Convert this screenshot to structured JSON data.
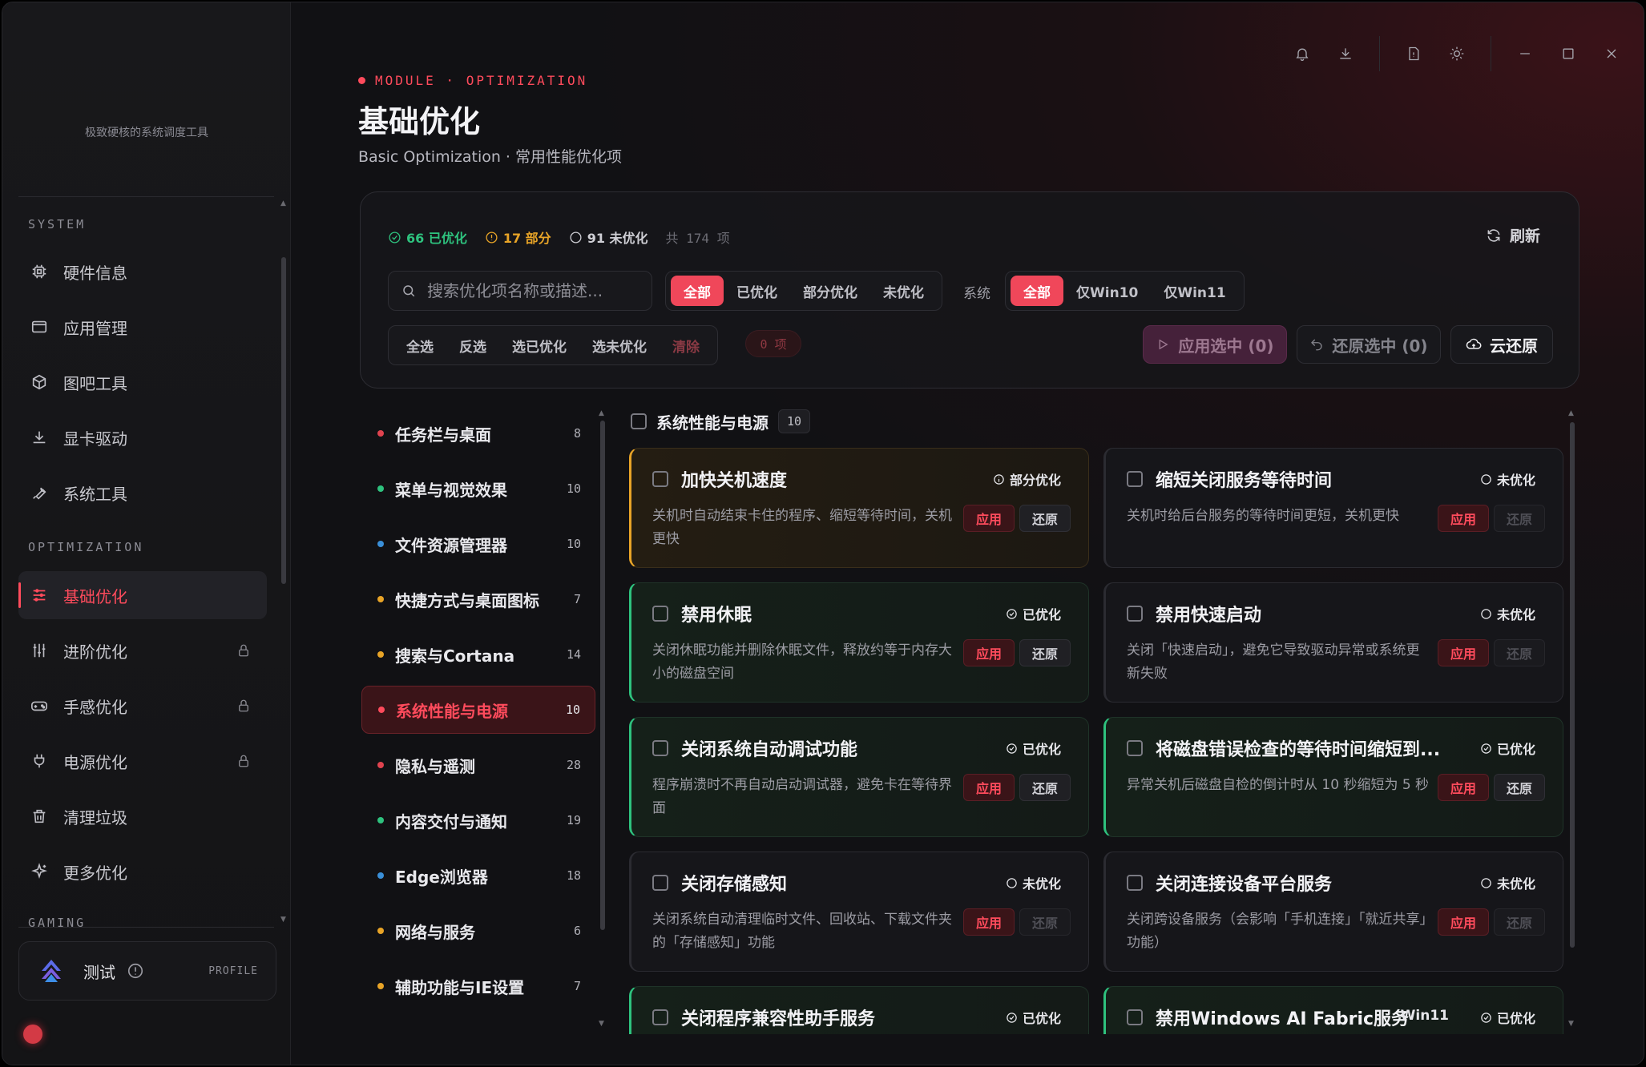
{
  "brand": {
    "tagline": "极致硬核的系统调度工具"
  },
  "sidebar": {
    "sections": [
      {
        "label": "SYSTEM"
      },
      {
        "label": "OPTIMIZATION"
      },
      {
        "label": "GAMING"
      }
    ],
    "items": [
      {
        "label": "硬件信息",
        "icon": "chip-icon",
        "locked": false,
        "active": false
      },
      {
        "label": "应用管理",
        "icon": "window-icon",
        "locked": false,
        "active": false
      },
      {
        "label": "图吧工具",
        "icon": "box-icon",
        "locked": false,
        "active": false
      },
      {
        "label": "显卡驱动",
        "icon": "download-icon",
        "locked": false,
        "active": false
      },
      {
        "label": "系统工具",
        "icon": "wrench-icon",
        "locked": false,
        "active": false
      },
      {
        "label": "基础优化",
        "icon": "sliders-icon",
        "locked": false,
        "active": true
      },
      {
        "label": "进阶优化",
        "icon": "tuning-icon",
        "locked": true,
        "active": false
      },
      {
        "label": "手感优化",
        "icon": "gamepad-icon",
        "locked": true,
        "active": false
      },
      {
        "label": "电源优化",
        "icon": "plug-icon",
        "locked": true,
        "active": false
      },
      {
        "label": "清理垃圾",
        "icon": "trash-icon",
        "locked": false,
        "active": false
      },
      {
        "label": "更多优化",
        "icon": "sparkle-icon",
        "locked": false,
        "active": false
      }
    ],
    "profile": {
      "name": "测试",
      "label": "PROFILE"
    }
  },
  "header": {
    "module_tag": "MODULE · OPTIMIZATION",
    "title": "基础优化",
    "subtitle": "Basic Optimization · 常用性能优化项"
  },
  "stats": {
    "optimized": "66 已优化",
    "partial": "17 部分",
    "unoptimized": "91 未优化",
    "total": "共 174 项",
    "refresh_label": "刷新"
  },
  "search": {
    "placeholder": "搜索优化项名称或描述..."
  },
  "filters": {
    "status": [
      "全部",
      "已优化",
      "部分优化",
      "未优化"
    ],
    "status_selected": "全部",
    "system_label": "系统",
    "system": [
      "全部",
      "仅Win10",
      "仅Win11"
    ],
    "system_selected": "全部"
  },
  "selection": {
    "actions": [
      "全选",
      "反选",
      "选已优化",
      "选未优化",
      "清除"
    ],
    "count": "0 项",
    "apply_selected": "应用选中 (0)",
    "restore_selected": "还原选中 (0)",
    "cloud_restore": "云还原"
  },
  "categories": [
    {
      "name": "任务栏与桌面",
      "count": "8",
      "dot": "#e0434f",
      "active": false
    },
    {
      "name": "菜单与视觉效果",
      "count": "10",
      "dot": "#2ec27e",
      "active": false
    },
    {
      "name": "文件资源管理器",
      "count": "10",
      "dot": "#3a8fd8",
      "active": false
    },
    {
      "name": "快捷方式与桌面图标",
      "count": "7",
      "dot": "#e8a427",
      "active": false
    },
    {
      "name": "搜索与Cortana",
      "count": "14",
      "dot": "#e8a427",
      "active": false
    },
    {
      "name": "系统性能与电源",
      "count": "10",
      "dot": "#ff4b5c",
      "active": true
    },
    {
      "name": "隐私与遥测",
      "count": "28",
      "dot": "#e0434f",
      "active": false
    },
    {
      "name": "内容交付与通知",
      "count": "19",
      "dot": "#2ec27e",
      "active": false
    },
    {
      "name": "Edge浏览器",
      "count": "18",
      "dot": "#3a8fd8",
      "active": false
    },
    {
      "name": "网络与服务",
      "count": "6",
      "dot": "#e8a427",
      "active": false
    },
    {
      "name": "辅助功能与IE设置",
      "count": "7",
      "dot": "#e8a427",
      "active": false
    }
  ],
  "group": {
    "title": "系统性能与电源",
    "count": "10"
  },
  "labels": {
    "apply": "应用",
    "restore": "还原"
  },
  "items": [
    {
      "title": "加快关机速度",
      "status": "部分优化",
      "state": "partial",
      "desc": "关机时自动结束卡住的程序、缩短等待时间，关机更快",
      "restore_enabled": true,
      "tag": ""
    },
    {
      "title": "缩短关闭服务等待时间",
      "status": "未优化",
      "state": "none",
      "desc": "关机时给后台服务的等待时间更短，关机更快",
      "restore_enabled": false,
      "tag": ""
    },
    {
      "title": "禁用休眠",
      "status": "已优化",
      "state": "ok",
      "desc": "关闭休眠功能并删除休眠文件，释放约等于内存大小的磁盘空间",
      "restore_enabled": true,
      "tag": ""
    },
    {
      "title": "禁用快速启动",
      "status": "未优化",
      "state": "none",
      "desc": "关闭「快速启动」，避免它导致驱动异常或系统更新失败",
      "restore_enabled": false,
      "tag": ""
    },
    {
      "title": "关闭系统自动调试功能",
      "status": "已优化",
      "state": "ok",
      "desc": "程序崩溃时不再自动启动调试器，避免卡在等待界面",
      "restore_enabled": true,
      "tag": ""
    },
    {
      "title": "将磁盘错误检查的等待时间缩短到...",
      "status": "已优化",
      "state": "ok",
      "desc": "异常关机后磁盘自检的倒计时从 10 秒缩短为 5 秒",
      "restore_enabled": true,
      "tag": ""
    },
    {
      "title": "关闭存储感知",
      "status": "未优化",
      "state": "none",
      "desc": "关闭系统自动清理临时文件、回收站、下载文件夹的「存储感知」功能",
      "restore_enabled": false,
      "tag": ""
    },
    {
      "title": "关闭连接设备平台服务",
      "status": "未优化",
      "state": "none",
      "desc": "关闭跨设备服务（会影响「手机连接」「就近共享」功能）",
      "restore_enabled": false,
      "tag": ""
    },
    {
      "title": "关闭程序兼容性助手服务",
      "status": "已优化",
      "state": "ok",
      "desc": "",
      "restore_enabled": true,
      "tag": ""
    },
    {
      "title": "禁用Windows AI Fabric服务",
      "status": "已优化",
      "state": "ok",
      "desc": "",
      "restore_enabled": true,
      "tag": "Win11"
    }
  ],
  "colors": {
    "accent": "#ff4b5c",
    "ok": "#2ec27e",
    "partial": "#e8a427"
  }
}
